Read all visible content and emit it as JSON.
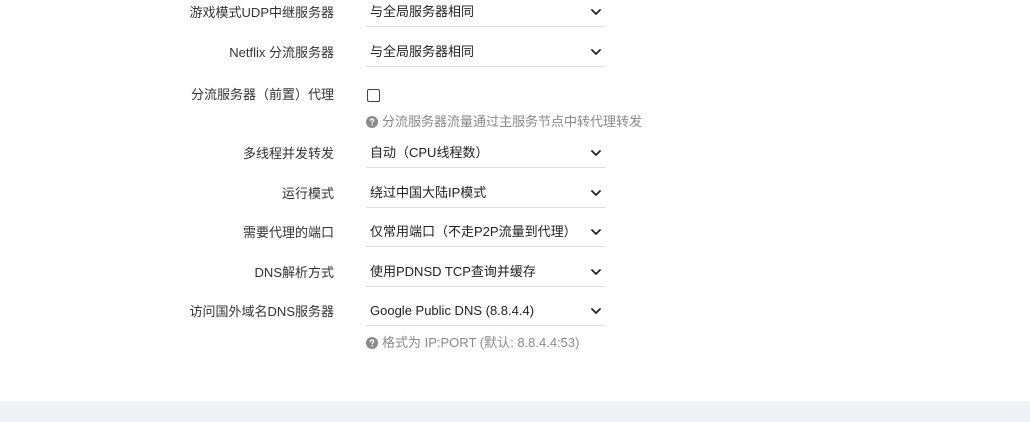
{
  "settings": {
    "game_udp_relay": {
      "label": "游戏模式UDP中继服务器",
      "value": "与全局服务器相同",
      "icon": "chevron-down-icon"
    },
    "netflix_server": {
      "label": "Netflix 分流服务器",
      "value": "与全局服务器相同",
      "icon": "chevron-down-icon"
    },
    "shunt_proxy": {
      "label": "分流服务器（前置）代理",
      "checked": false,
      "help": "分流服务器流量通过主服务节点中转代理转发",
      "help_icon": "question-circle-icon"
    },
    "threads": {
      "label": "多线程并发转发",
      "value": "自动（CPU线程数）",
      "icon": "chevron-down-icon"
    },
    "run_mode": {
      "label": "运行模式",
      "value": "绕过中国大陆IP模式",
      "icon": "chevron-down-icon"
    },
    "proxy_ports": {
      "label": "需要代理的端口",
      "value": "仅常用端口（不走P2P流量到代理）",
      "icon": "chevron-down-icon"
    },
    "dns_mode": {
      "label": "DNS解析方式",
      "value": "使用PDNSD TCP查询并缓存",
      "icon": "chevron-down-icon"
    },
    "foreign_dns": {
      "label": "访问国外域名DNS服务器",
      "value": "Google Public DNS (8.8.4.4)",
      "icon": "chevron-down-icon",
      "help": "格式为 IP:PORT (默认: 8.8.4.4:53)",
      "help_icon": "question-circle-icon"
    }
  },
  "colors": {
    "label": "#333333",
    "help": "#8a8a8a",
    "underline": "#dcdfe4",
    "footer": "#eef1f5"
  }
}
